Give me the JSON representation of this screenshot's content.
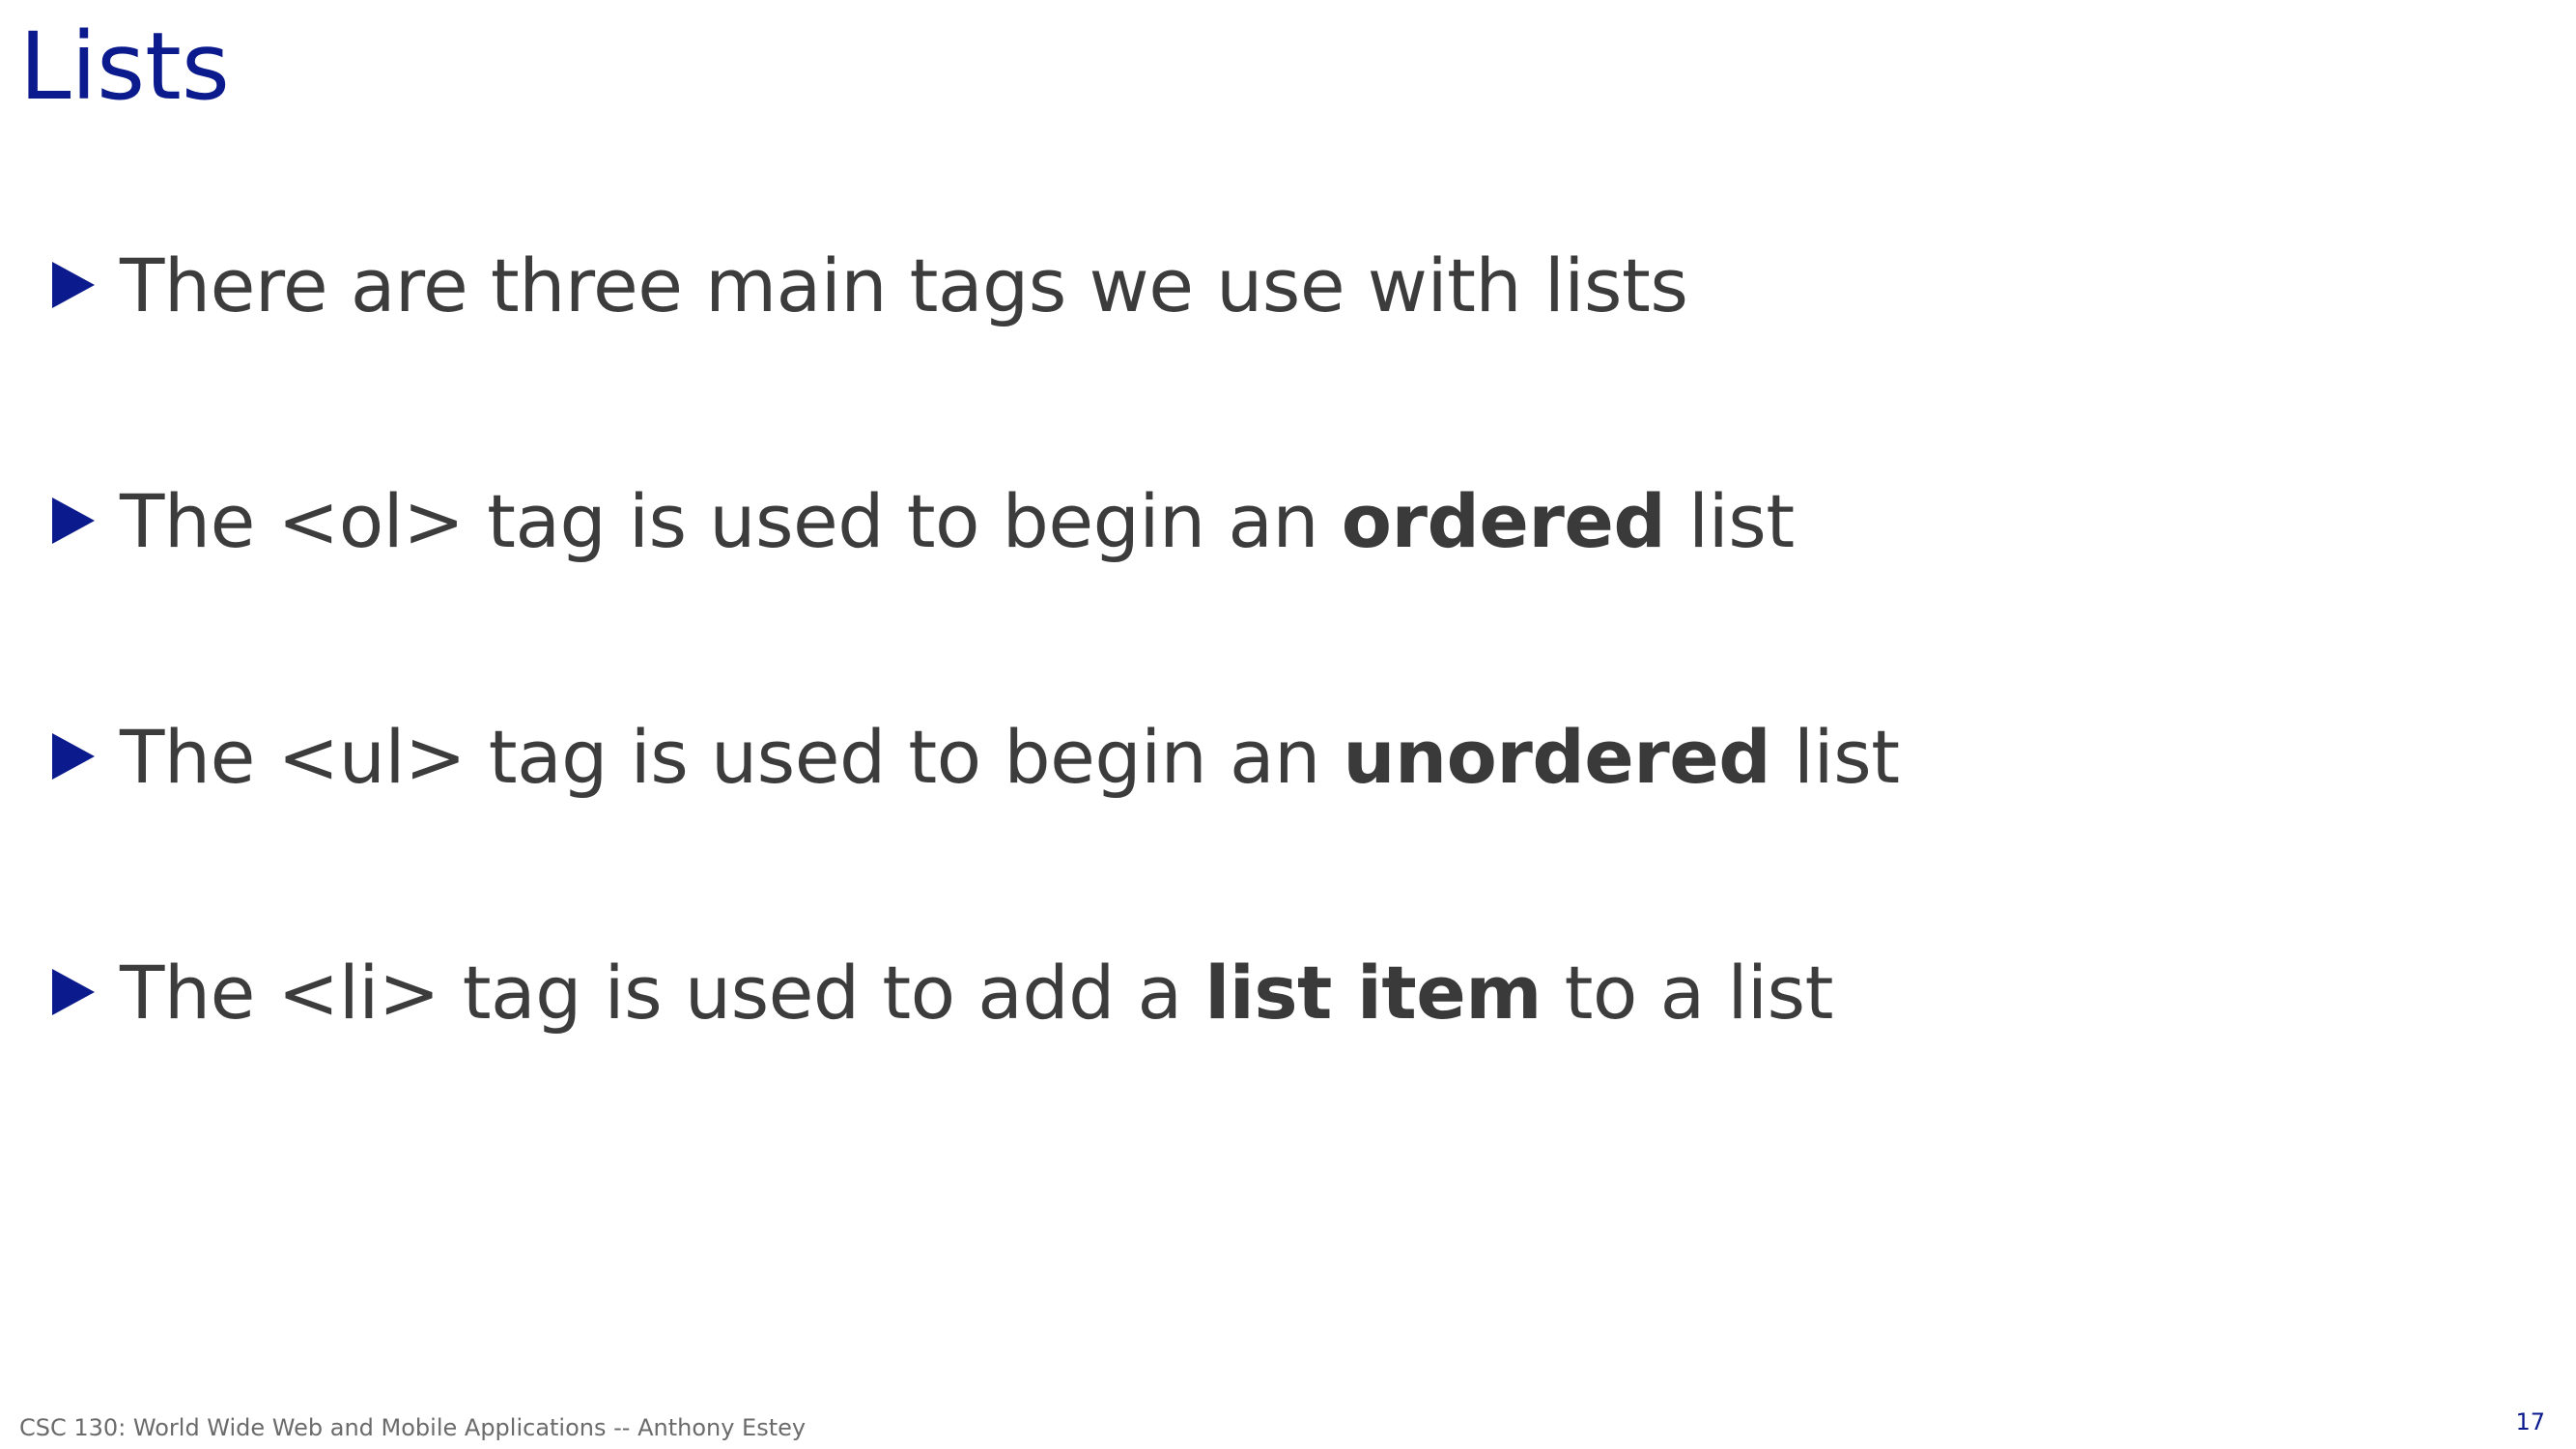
{
  "slide": {
    "title": "Lists",
    "bullets": [
      {
        "before": "There are three main tags we use with lists",
        "bold": "",
        "after": ""
      },
      {
        "before": "The <ol> tag is used to begin an ",
        "bold": "ordered",
        "after": " list"
      },
      {
        "before": "The <ul> tag is used to begin an ",
        "bold": "unordered",
        "after": " list"
      },
      {
        "before": "The <li> tag is used to add a ",
        "bold": "list item",
        "after": " to a list"
      }
    ],
    "footer": "CSC 130: World Wide Web and Mobile Applications -- Anthony Estey",
    "page_number": "17"
  },
  "colors": {
    "title": "#0b1a8c",
    "bullet_marker": "#0b1a8c",
    "body_text": "#3c3c3c",
    "footer_text": "#6b6b6b",
    "page_number": "#0b1a8c"
  },
  "icons": {
    "bullet": "triangle-right-icon"
  }
}
